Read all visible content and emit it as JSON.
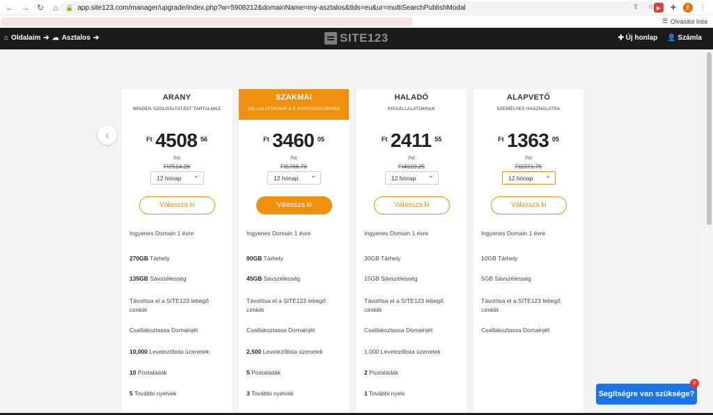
{
  "browser": {
    "url": "app.site123.com/manager/upgrade/index.php?w=5908212&domainName=my-asztalos&tlds=eu&ur=multiSearchPublishModal",
    "profile_initial": "É",
    "reading_list": "Olvasási lista"
  },
  "header": {
    "crumb1": "Oldalaim",
    "crumb2": "Asztalos",
    "logo_text": "SITE123",
    "new_site": "Új honlap",
    "account": "Számla"
  },
  "plans": [
    {
      "name": "ARANY",
      "subtitle": "MINDEN SZOLGÁLTATÁST TARTALMAZ",
      "currency": "Ft",
      "whole": "4508",
      "cents": "56",
      "per": "/hó",
      "old": "Ft7514.26",
      "period": "12 hónap",
      "cta": "Válassza ki",
      "f_domain": "Ingyenes Domain 1 évre",
      "f_storage_val": "270GB",
      "f_storage_lbl": " Tárhely",
      "f_bw_val": "135GB",
      "f_bw_lbl": " Sávszélesség",
      "f_remove": "Távolítsa el a SITE123 lebegő címkét",
      "f_connect": "Csatlakoztassa Domainjét",
      "f_mail_val": "10,000",
      "f_mail_lbl": " Levelezőlista üzenetek",
      "f_box_val": "10",
      "f_box_lbl": " Postaládák",
      "f_lang_val": "5",
      "f_lang_lbl": " További nyelvek"
    },
    {
      "name": "SZAKMAI",
      "subtitle": "VÁLLALATOKNAK & E-KERESKEDŐKNEK",
      "currency": "Ft",
      "whole": "3460",
      "cents": "05",
      "per": "/hó",
      "old": "Ft5766.76",
      "period": "12 hónap",
      "cta": "Válassza ki",
      "f_domain": "Ingyenes Domain 1 évre",
      "f_storage_val": "90GB",
      "f_storage_lbl": " Tárhely",
      "f_bw_val": "45GB",
      "f_bw_lbl": " Sávszélesség",
      "f_remove": "Távolítsa el a SITE123 lebegő címkét",
      "f_connect": "Csatlakoztassa Domainjét",
      "f_mail_val": "2,500",
      "f_mail_lbl": " Levelezőlista üzenetek",
      "f_box_val": "5",
      "f_box_lbl": " Postaládák",
      "f_lang_val": "3",
      "f_lang_lbl": " További nyelvek"
    },
    {
      "name": "HALADÓ",
      "subtitle": "KISVÁLLALATOKNAK",
      "currency": "Ft",
      "whole": "2411",
      "cents": "55",
      "per": "/hó",
      "old": "Ft4019.25",
      "period": "12 hónap",
      "cta": "Válassza ki",
      "f_domain": "Ingyenes Domain 1 évre",
      "f_storage_val": "",
      "f_storage_lbl": "30GB Tárhely",
      "f_bw_val": "",
      "f_bw_lbl": "15GB Sávszélesség",
      "f_remove": "Távolítsa el a SITE123 lebegő címkét",
      "f_connect": "Csatlakoztassa Domainjét",
      "f_mail_val": "",
      "f_mail_lbl": "1,000 Levelezőlista üzenetek",
      "f_box_val": "2",
      "f_box_lbl": " Postaládák",
      "f_lang_val": "1",
      "f_lang_lbl": " További nyelv"
    },
    {
      "name": "ALAPVETŐ",
      "subtitle": "SZEMÉLYES HASZNÁLATRA",
      "currency": "Ft",
      "whole": "1363",
      "cents": "05",
      "per": "/hó",
      "old": "Ft2271.75",
      "period": "12 hónap",
      "cta": "Válassza ki",
      "f_domain": "Ingyenes Domain 1 évre",
      "f_storage_val": "",
      "f_storage_lbl": "10GB Tárhely",
      "f_bw_val": "",
      "f_bw_lbl": "5GB Sávszélesség",
      "f_remove": "Távolítsa el a SITE123 lebegő címkét",
      "f_connect": "Csatlakoztassa Domainjét"
    }
  ],
  "help": {
    "label": "Segítségre van szüksége?",
    "badge": "2"
  }
}
